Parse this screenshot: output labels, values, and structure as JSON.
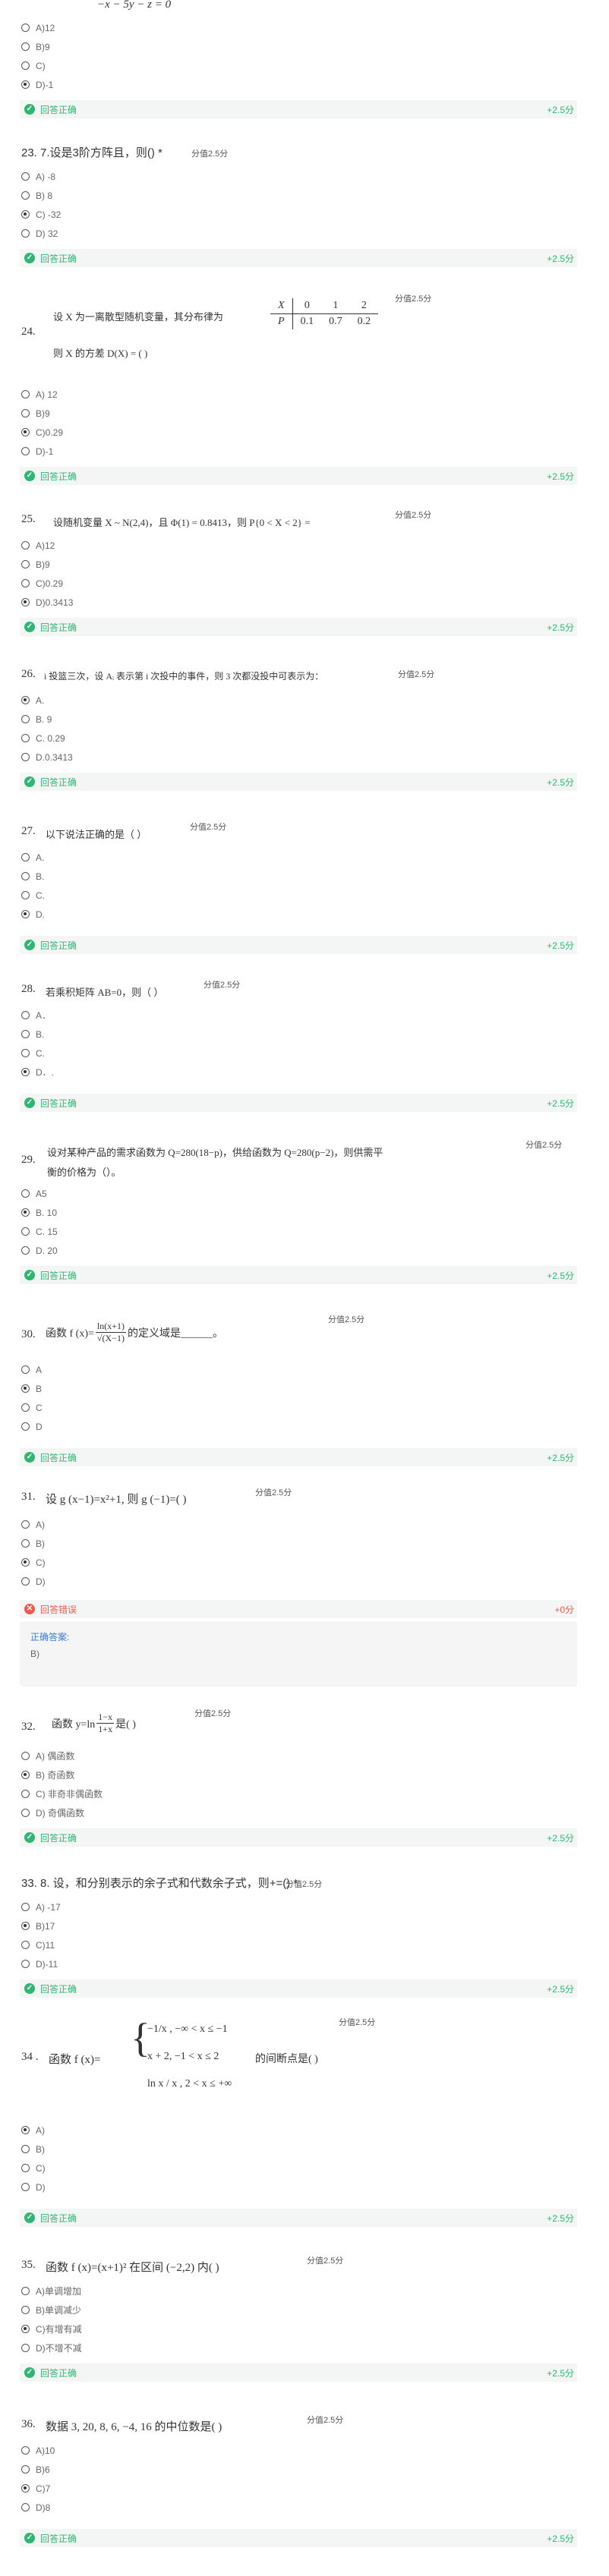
{
  "top_equation": "−x − 5y − z = 0",
  "q22": {
    "options": [
      "A)12",
      "B)9",
      "C)",
      "D)-1"
    ],
    "selected": 3,
    "status": "回答正确",
    "points": "+2.5分"
  },
  "q23": {
    "title": "23. 7.设是3阶方阵且，则() *",
    "score": "分值2.5分",
    "options": [
      "A) -8",
      "B) 8",
      "C) -32",
      "D) 32"
    ],
    "selected": 2,
    "status": "回答正确",
    "points": "+2.5分"
  },
  "q24": {
    "num": "24.",
    "line1": "设 X 为一离散型随机变量，其分布律为",
    "line2": "则 X 的方差 D(X) = (      )",
    "table_x": [
      "X",
      "0",
      "1",
      "2"
    ],
    "table_p": [
      "P",
      "0.1",
      "0.7",
      "0.2"
    ],
    "score": "分值2.5分",
    "options": [
      "A) 12",
      "B)9",
      "C)0.29",
      "D)-1"
    ],
    "selected": 2,
    "status": "回答正确",
    "points": "+2.5分"
  },
  "q25": {
    "num": "25.",
    "text": "设随机变量 X ~ N(2,4)，且 Φ(1) = 0.8413，则 P{0 < X < 2} =",
    "score": "分值2.5分",
    "options": [
      "A)12",
      "B)9",
      "C)0.29",
      "D)0.3413"
    ],
    "selected": 3,
    "status": "回答正确",
    "points": "+2.5分"
  },
  "q26": {
    "num": "26.",
    "text": "i 投篮三次，设 Aᵢ 表示第 i 次投中的事件，则 3 次都没投中可表示为：",
    "score": "分值2.5分",
    "options": [
      "A.",
      "B. 9",
      "C. 0.29",
      "D.0.3413"
    ],
    "selected": 0,
    "status": "回答正确",
    "points": "+2.5分"
  },
  "q27": {
    "num": "27.",
    "text": "以下说法正确的是（  ）",
    "score": "分值2.5分",
    "options": [
      "A.",
      "B.",
      "C.",
      "D."
    ],
    "selected": 3,
    "status": "回答正确",
    "points": "+2.5分"
  },
  "q28": {
    "num": "28.",
    "text": "若乘积矩阵 AB=0，则（  ）",
    "score": "分值2.5分",
    "options": [
      "A．",
      "B.",
      "C.",
      "D．."
    ],
    "selected": 3,
    "status": "回答正确",
    "points": "+2.5分"
  },
  "q29": {
    "num": "29.",
    "line1": "设对某种产品的需求函数为 Q=280(18−p)，供给函数为 Q=280(p−2)，则供需平",
    "line2": "衡的价格为（）。",
    "score": "分值2.5分",
    "options": [
      "A5",
      "B. 10",
      "C. 15",
      "D. 20"
    ],
    "selected": 1,
    "status": "回答正确",
    "points": "+2.5分"
  },
  "q30": {
    "num": "30.",
    "pre": "函数 f (x)=",
    "frac_n": "ln(x+1)",
    "frac_d": "√(X−1)",
    "post": "的定义域是______。",
    "score": "分值2.5分",
    "options": [
      "A",
      "B",
      "C",
      "D"
    ],
    "selected": 1,
    "status": "回答正确",
    "points": "+2.5分"
  },
  "q31": {
    "num": "31.",
    "text": "设 g (x−1)=x²+1, 则 g (−1)=(  )",
    "score": "分值2.5分",
    "options": [
      "A)",
      "B)",
      "C)",
      "D)"
    ],
    "selected": 2,
    "status": "回答错误",
    "points": "+0分",
    "answer_label": "正确答案:",
    "answer_value": "B)"
  },
  "q32": {
    "num": "32.",
    "pre": "函数 y=ln",
    "frac_n": "1−x",
    "frac_d": "1+x",
    "post": "是(  )",
    "score": "分值2.5分",
    "options": [
      "A) 偶函数",
      "B) 奇函数",
      "C) 非奇非偶函数",
      "D) 奇偶函数"
    ],
    "selected": 1,
    "status": "回答正确",
    "points": "+2.5分"
  },
  "q33": {
    "title": "33. 8. 设，和分别表示的余子式和代数余子式，则+=() *",
    "score": "分值2.5分",
    "options": [
      "A) -17",
      "B)17",
      "C)11",
      "D)-11"
    ],
    "selected": 1,
    "status": "回答正确",
    "points": "+2.5分"
  },
  "q34": {
    "num": "34 .",
    "pre": "函数 f (x)=",
    "piece1": "−1/x , −∞ < x ≤ −1",
    "piece2": "x + 2, −1 < x ≤ 2",
    "piece3": "ln x / x , 2 < x ≤ +∞",
    "post": "的间断点是(  )",
    "score": "分值2.5分",
    "options": [
      "A)",
      "B)",
      "C)",
      "D)"
    ],
    "selected": 0,
    "status": "回答正确",
    "points": "+2.5分"
  },
  "q35": {
    "num": "35.",
    "text": "函数 f (x)=(x+1)² 在区间 (−2,2) 内(  )",
    "score": "分值2.5分",
    "options": [
      "A)单调增加",
      "B)单调减少",
      "C)有增有减",
      "D)不增不减"
    ],
    "selected": 2,
    "status": "回答正确",
    "points": "+2.5分"
  },
  "q36": {
    "num": "36.",
    "text": "数据 3, 20, 8, 6, −4, 16 的中位数是(  )",
    "score": "分值2.5分",
    "options": [
      "A)10",
      "B)6",
      "C)7",
      "D)8"
    ],
    "selected": 2,
    "status": "回答正确",
    "points": "+2.5分"
  }
}
